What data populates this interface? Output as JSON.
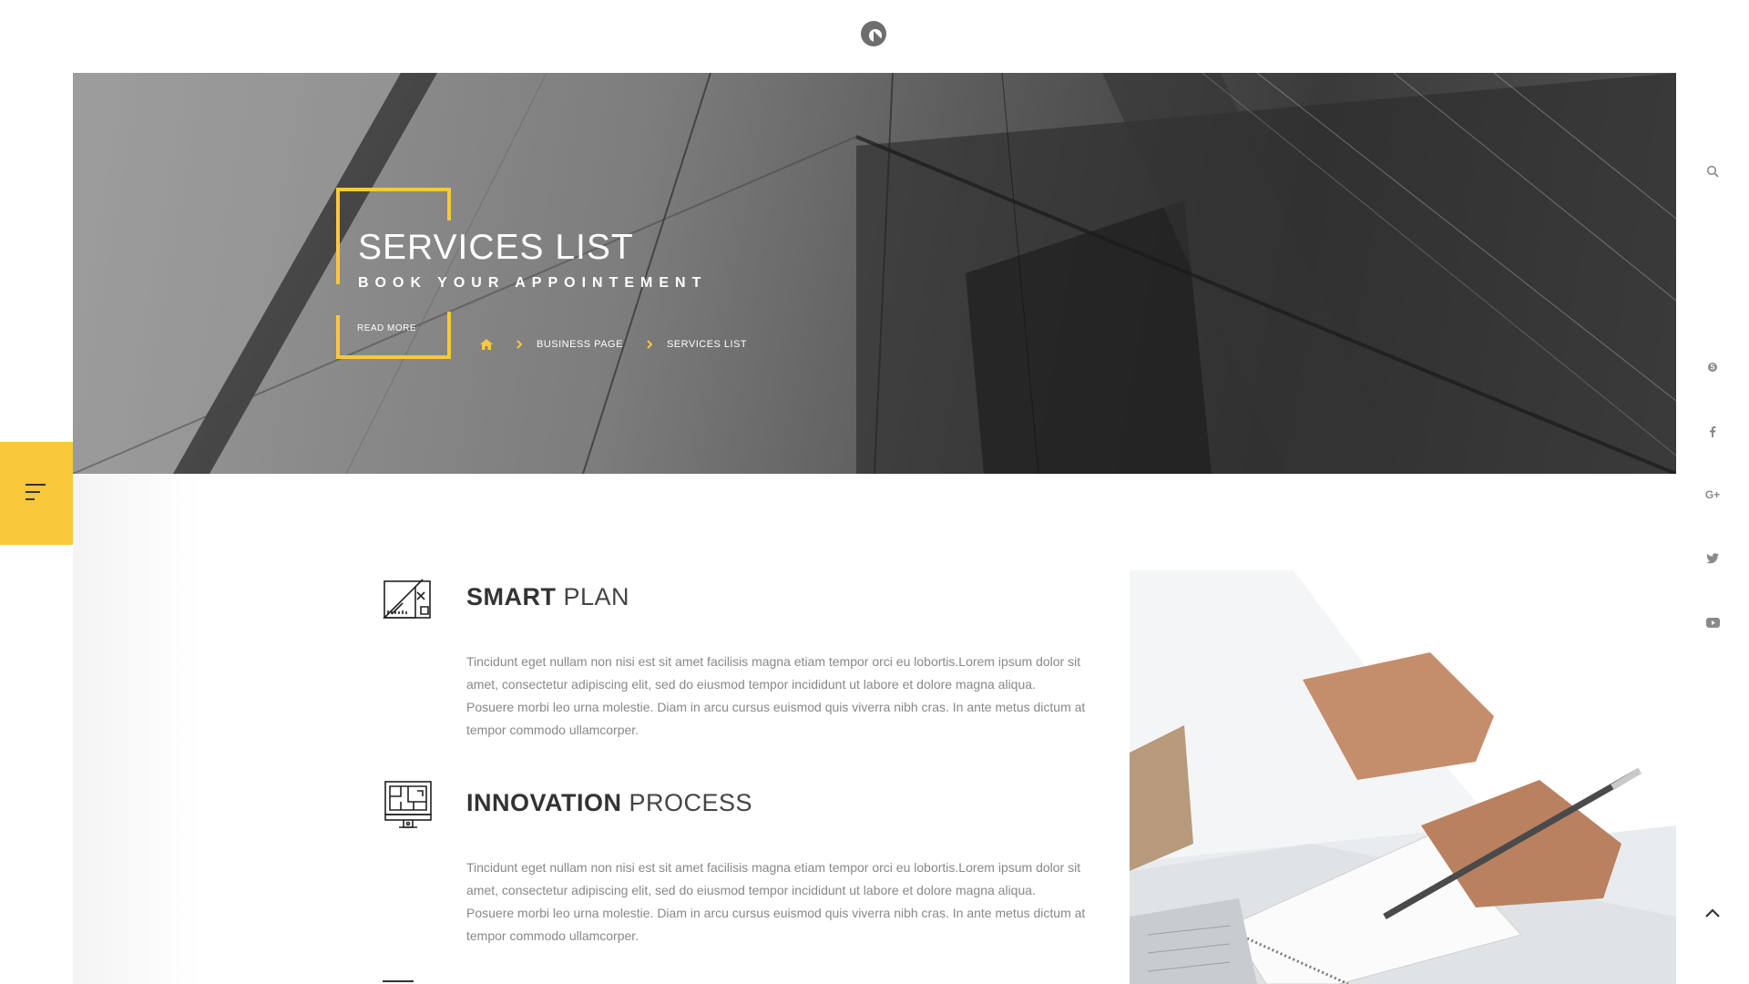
{
  "hero": {
    "title": "SERVICES LIST",
    "subtitle": "BOOK YOUR APPOINTEMENT",
    "read_more": "READ MORE",
    "breadcrumb": [
      "BUSINESS PAGE",
      "SERVICES LIST"
    ]
  },
  "services": [
    {
      "title_strong": "SMART",
      "title_light": "PLAN",
      "description": "Tincidunt eget nullam non nisi est sit amet facilisis magna etiam tempor orci eu lobortis.Lorem ipsum dolor sit amet, consectetur adipiscing elit, sed do eiusmod tempor incididunt ut labore et dolore magna aliqua. Posuere morbi leo urna molestie. Diam in arcu cursus euismod quis viverra nibh cras. In ante metus dictum at tempor commodo ullamcorper.",
      "icon": "blueprint-icon"
    },
    {
      "title_strong": "INNOVATION",
      "title_light": "PROCESS",
      "description": "Tincidunt eget nullam non nisi est sit amet facilisis magna etiam tempor orci eu lobortis.Lorem ipsum dolor sit amet, consectetur adipiscing elit, sed do eiusmod tempor incididunt ut labore et dolore magna aliqua. Posuere morbi leo urna molestie. Diam in arcu cursus euismod quis viverra nibh cras. In ante metus dictum at tempor commodo ullamcorper.",
      "icon": "monitor-plan-icon"
    }
  ],
  "right_rail": {
    "icons": [
      "search-icon",
      "skype-icon",
      "facebook-icon",
      "google-plus-icon",
      "twitter-icon",
      "youtube-icon",
      "chevron-up-icon"
    ],
    "google_plus_text": "G+"
  },
  "colors": {
    "accent": "#fac83b",
    "text_dark": "#333333",
    "text_muted": "#888888",
    "icon_gray": "#8a8a8a"
  }
}
